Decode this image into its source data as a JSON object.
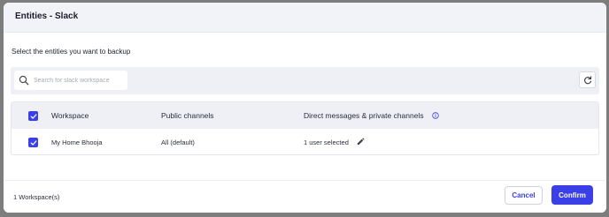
{
  "modal": {
    "title": "Entities - Slack",
    "subtitle": "Select the entities you want to backup"
  },
  "search": {
    "placeholder": "Search for slack workspace",
    "value": ""
  },
  "table": {
    "headers": [
      "Workspace",
      "Public channels",
      "Direct messages & private channels"
    ],
    "rows": [
      {
        "checked": true,
        "workspace": "My Home Bhooja",
        "public_channels": "All (default)",
        "direct_messages": "1 user selected"
      }
    ],
    "select_all_checked": true
  },
  "footer": {
    "count": "1 Workspace(s)",
    "cancel_label": "Cancel",
    "confirm_label": "Confirm"
  },
  "icons": {
    "search": "search-icon",
    "refresh": "refresh-icon",
    "info": "info-icon",
    "edit": "pencil-icon",
    "checkbox": "check-icon"
  },
  "colors": {
    "accent": "#3b3fe8",
    "header_bg": "#f1f3f8",
    "table_header_bg": "#eef0f6",
    "backdrop": "#7d7d7d"
  }
}
